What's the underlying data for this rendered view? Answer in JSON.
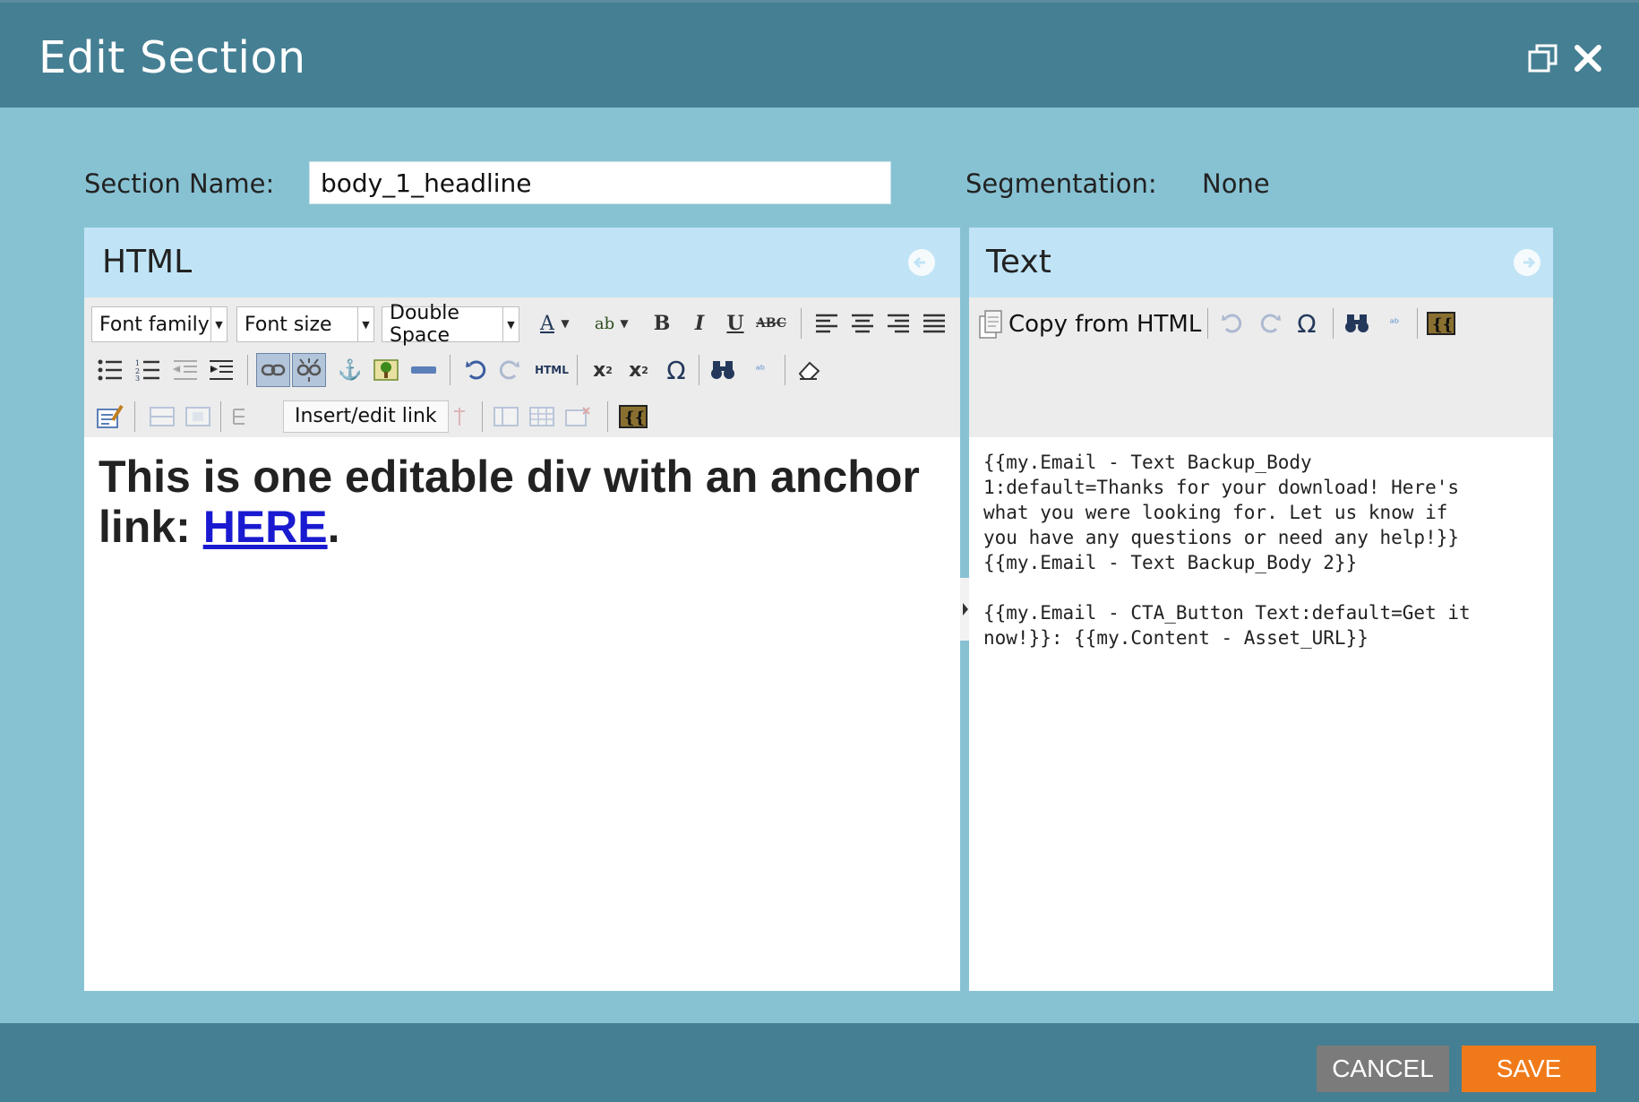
{
  "window": {
    "title": "Edit Section"
  },
  "form": {
    "section_name_label": "Section Name:",
    "section_name_value": "body_1_headline",
    "segmentation_label": "Segmentation:",
    "segmentation_value": "None"
  },
  "html_panel": {
    "title": "HTML",
    "font_family": "Font family",
    "font_size": "Font size",
    "line_spacing": "Double Space",
    "tooltip": "Insert/edit link",
    "content_text": "This is one editable div with an anchor link: ",
    "content_link": "HERE",
    "content_end": "."
  },
  "text_panel": {
    "title": "Text",
    "copy_from_html": "Copy from HTML",
    "content": "{{my.Email - Text Backup_Body\n1:default=Thanks for your download! Here's\nwhat you were looking for. Let us know if\nyou have any questions or need any help!}}\n{{my.Email - Text Backup_Body 2}}\n\n{{my.Email - CTA_Button Text:default=Get it\nnow!}}: {{my.Content - Asset_URL}}"
  },
  "footer": {
    "cancel_label": "CANCEL",
    "save_label": "SAVE"
  },
  "colors": {
    "header": "#457f93",
    "background": "#87c2d3",
    "panel_header": "#c0e4f6",
    "save": "#f07a1a",
    "cancel": "#7b7b7b",
    "link": "#1a1ad1"
  }
}
